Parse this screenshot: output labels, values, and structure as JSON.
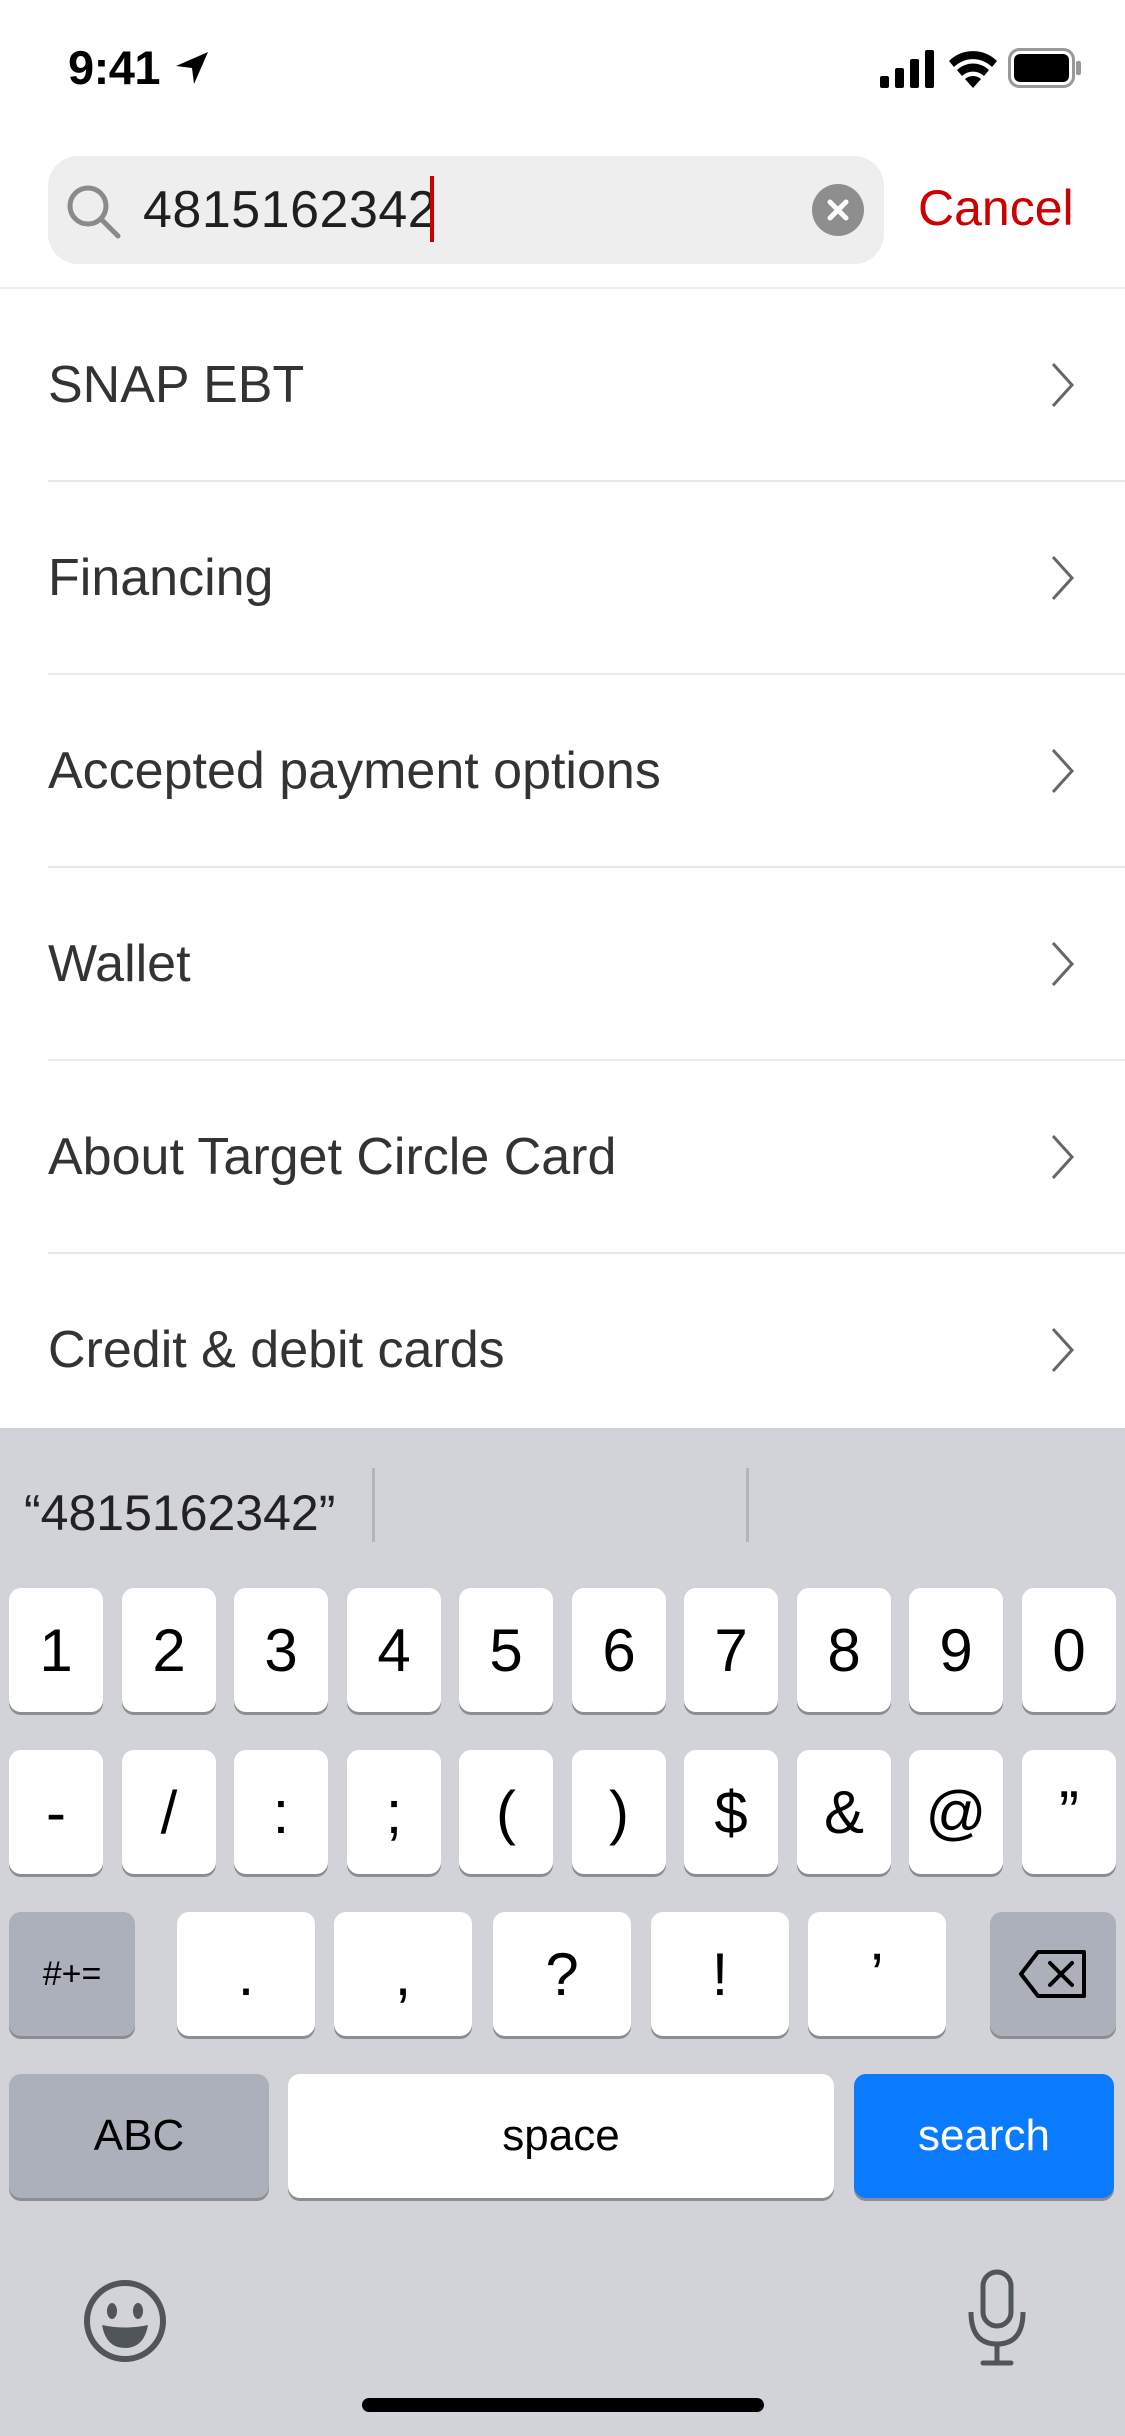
{
  "status_bar": {
    "time": "9:41",
    "icons": [
      "location-arrow-icon",
      "cellular-signal-icon",
      "wifi-icon",
      "battery-icon"
    ]
  },
  "search": {
    "value": "4815162342",
    "clear_icon": "clear-circle-icon",
    "cancel_label": "Cancel",
    "accent_color": "#cc0000"
  },
  "results": [
    {
      "label": "SNAP EBT"
    },
    {
      "label": "Financing"
    },
    {
      "label": "Accepted payment options"
    },
    {
      "label": "Wallet"
    },
    {
      "label": "About Target Circle Card"
    },
    {
      "label": "Credit & debit cards"
    }
  ],
  "keyboard": {
    "suggestion": "“4815162342”",
    "row1": [
      "1",
      "2",
      "3",
      "4",
      "5",
      "6",
      "7",
      "8",
      "9",
      "0"
    ],
    "row2": [
      "-",
      "/",
      ":",
      ";",
      "(",
      ")",
      "$",
      "&",
      "@",
      "”"
    ],
    "row3": {
      "mode_key": "#+=",
      "keys": [
        ".",
        ",",
        "?",
        "!",
        "’"
      ],
      "delete_icon": "backspace-icon"
    },
    "row4": {
      "abc_key": "ABC",
      "space_key": "space",
      "search_key": "search",
      "search_color": "#0a7aff"
    },
    "bottom_icons": [
      "emoji-icon",
      "microphone-icon"
    ]
  }
}
